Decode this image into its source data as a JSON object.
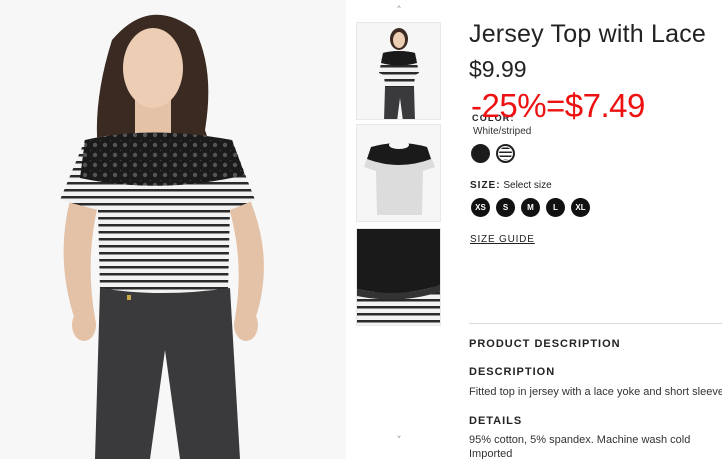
{
  "product": {
    "title": "Jersey Top with Lace",
    "price": "$9.99",
    "discount_label": "-25%=$7.49",
    "discount_color": "#ee1111"
  },
  "gallery": {
    "main_image": "woman-in-striped-lace-top-photo",
    "thumbnails": [
      "model-front-thumbnail",
      "flat-top-thumbnail",
      "lace-detail-thumbnail"
    ],
    "scroll_up_glyph": "˄",
    "scroll_down_glyph": "˅"
  },
  "color": {
    "label": "COLOR:",
    "selected": "White/striped",
    "swatches": [
      {
        "name": "Black",
        "hex": "#1b1b1b"
      },
      {
        "name": "White/striped",
        "hex": "#ffffff"
      }
    ]
  },
  "size": {
    "label": "SIZE:",
    "placeholder": "Select size",
    "options": [
      "XS",
      "S",
      "M",
      "L",
      "XL"
    ],
    "guide_label": "SIZE GUIDE"
  },
  "description": {
    "section_title": "PRODUCT DESCRIPTION",
    "heading": "DESCRIPTION",
    "text": "Fitted top in jersey with a lace yoke and short sleeves.",
    "details_heading": "DETAILS",
    "details_line1": "95% cotton, 5% spandex. Machine wash cold",
    "details_line2": "Imported"
  }
}
